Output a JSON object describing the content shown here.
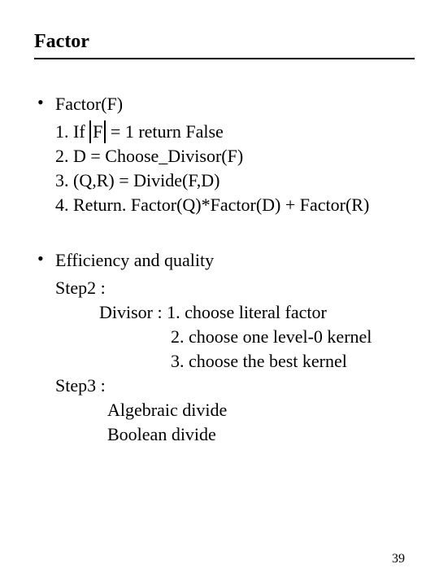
{
  "title": "Factor",
  "block1": {
    "head": "Factor(F)",
    "line1_pre": "1. If ",
    "line1_F": "F",
    "line1_post": " = 1 return False",
    "line2": "2. D = Choose_Divisor(F)",
    "line3": "3. (Q,R) = Divide(F,D)",
    "line4": "4. Return. Factor(Q)*Factor(D) + Factor(R)"
  },
  "block2": {
    "head": "Efficiency and quality",
    "step2": "Step2 :",
    "divisor_lead": "Divisor : 1. choose literal factor",
    "divisor2": "2. choose one level-0 kernel",
    "divisor3": "3. choose the best kernel",
    "step3": "Step3 :",
    "alg1": "Algebraic divide",
    "alg2": "Boolean divide"
  },
  "page": "39"
}
